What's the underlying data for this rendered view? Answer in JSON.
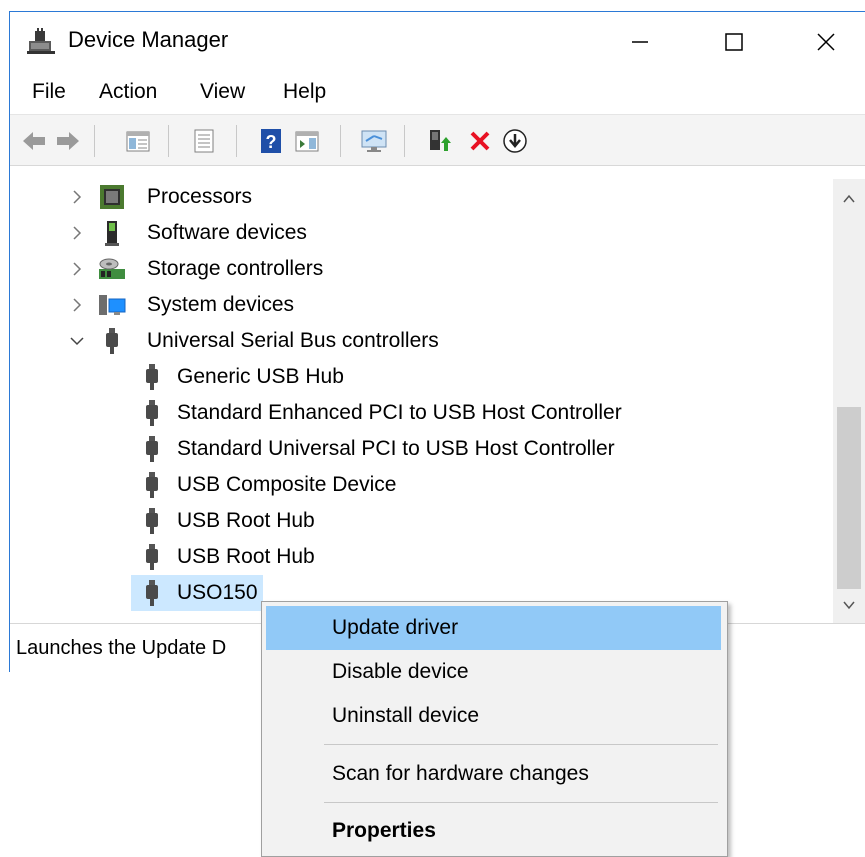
{
  "window": {
    "title": "Device Manager",
    "accent": "#2b79d6"
  },
  "menubar": {
    "items": [
      "File",
      "Action",
      "View",
      "Help"
    ]
  },
  "toolbar": {
    "icons": [
      "back-arrow-icon",
      "forward-arrow-icon",
      "show-hide-console-tree-icon",
      "properties-icon",
      "help-icon",
      "action-pane-icon",
      "monitor-icon",
      "update-driver-icon",
      "uninstall-icon",
      "download-icon"
    ]
  },
  "tree": {
    "categories": [
      {
        "label": "Processors",
        "expanded": false,
        "icon": "processor-icon"
      },
      {
        "label": "Software devices",
        "expanded": false,
        "icon": "software-device-icon"
      },
      {
        "label": "Storage controllers",
        "expanded": false,
        "icon": "storage-controller-icon"
      },
      {
        "label": "System devices",
        "expanded": false,
        "icon": "system-devices-icon"
      },
      {
        "label": "Universal Serial Bus controllers",
        "expanded": true,
        "icon": "usb-plug-icon"
      }
    ],
    "usb_devices": [
      {
        "label": "Generic USB Hub",
        "selected": false
      },
      {
        "label": "Standard Enhanced PCI to USB Host Controller",
        "selected": false
      },
      {
        "label": "Standard Universal PCI to USB Host Controller",
        "selected": false
      },
      {
        "label": "USB Composite Device",
        "selected": false
      },
      {
        "label": "USB Root Hub",
        "selected": false
      },
      {
        "label": "USB Root Hub",
        "selected": false
      },
      {
        "label": "USO150",
        "selected": true
      }
    ]
  },
  "statusbar": {
    "text": "Launches the Update D"
  },
  "context_menu": {
    "items": [
      {
        "label": "Update driver",
        "highlighted": true,
        "bold": false
      },
      {
        "label": "Disable device",
        "highlighted": false,
        "bold": false
      },
      {
        "label": "Uninstall device",
        "highlighted": false,
        "bold": false
      },
      {
        "label": "Scan for hardware changes",
        "highlighted": false,
        "bold": false
      },
      {
        "label": "Properties",
        "highlighted": false,
        "bold": true
      }
    ],
    "highlight_color": "#91c9f7"
  },
  "colors": {
    "selection": "#cce8ff",
    "uninstall_red": "#e81123",
    "help_blue": "#1f4fa8"
  }
}
